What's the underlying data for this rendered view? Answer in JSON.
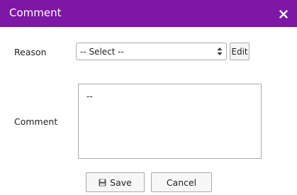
{
  "dialog": {
    "title": "Comment",
    "close_icon": "close-icon",
    "accent_color": "#7e17a6"
  },
  "form": {
    "reason": {
      "label": "Reason",
      "selected": "-- Select --",
      "edit_label": "Edit"
    },
    "comment": {
      "label": "Comment",
      "value": "--"
    }
  },
  "buttons": {
    "save_label": "Save",
    "save_icon": "floppy-disk-icon",
    "cancel_label": "Cancel"
  }
}
